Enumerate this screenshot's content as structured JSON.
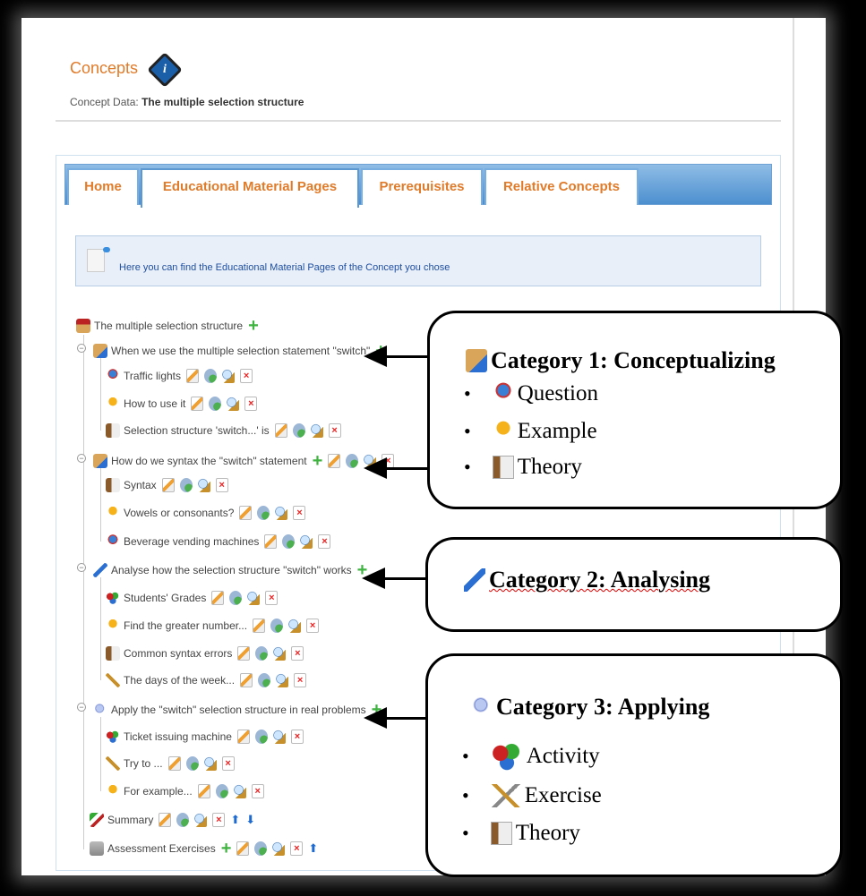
{
  "header": {
    "title": "Concepts",
    "info_icon": "info-icon",
    "concept_label": "Concept Data:",
    "concept_value": "The multiple selection structure"
  },
  "tabs": [
    {
      "label": "Home"
    },
    {
      "label": "Educational Material Pages",
      "active": true
    },
    {
      "label": "Prerequisites"
    },
    {
      "label": "Relative Concepts"
    }
  ],
  "info_message": "Here you can find the Educational Material Pages of the Concept you chose",
  "tree": {
    "root": "The multiple selection structure",
    "groups": [
      {
        "label": "When we use the multiple selection statement \"switch\"",
        "icon": "conceptualizing-icon",
        "items": [
          {
            "label": "Traffic lights",
            "icon": "question-icon"
          },
          {
            "label": "How to use it",
            "icon": "example-icon"
          },
          {
            "label": "Selection structure 'switch...' is",
            "icon": "theory-icon"
          }
        ]
      },
      {
        "label": "How do we syntax the \"switch\" statement",
        "icon": "conceptualizing-icon",
        "items": [
          {
            "label": "Syntax",
            "icon": "theory-icon"
          },
          {
            "label": "Vowels or consonants?",
            "icon": "example-icon"
          },
          {
            "label": "Beverage vending machines",
            "icon": "question-icon"
          }
        ]
      },
      {
        "label": "Analyse how the selection structure \"switch\" works",
        "icon": "analysing-icon",
        "items": [
          {
            "label": "Students' Grades",
            "icon": "activity-icon"
          },
          {
            "label": "Find the greater number...",
            "icon": "example-icon"
          },
          {
            "label": "Common syntax errors",
            "icon": "theory-icon"
          },
          {
            "label": "The days of the week...",
            "icon": "exercise-icon"
          }
        ]
      },
      {
        "label": "Apply the \"switch\" selection structure in real problems",
        "icon": "applying-icon",
        "items": [
          {
            "label": "Ticket issuing machine",
            "icon": "activity-icon"
          },
          {
            "label": "Try to ...",
            "icon": "exercise-icon"
          },
          {
            "label": "For example...",
            "icon": "example-icon"
          }
        ]
      }
    ],
    "summary": "Summary",
    "assessment": "Assessment Exercises"
  },
  "callouts": [
    {
      "title": "Category 1: Conceptualizing",
      "bullets": [
        "Question",
        "Example",
        "Theory"
      ]
    },
    {
      "title": "Category 2: Analysing",
      "bullets": []
    },
    {
      "title": "Category 3: Applying",
      "bullets": [
        "Activity",
        "Exercise",
        "Theory"
      ]
    }
  ],
  "colors": {
    "accent": "#e07b2a",
    "tab_bar": "#4c8fcf",
    "info_text": "#1f4fa0",
    "add": "#3fb33f",
    "delete": "#e22222"
  }
}
